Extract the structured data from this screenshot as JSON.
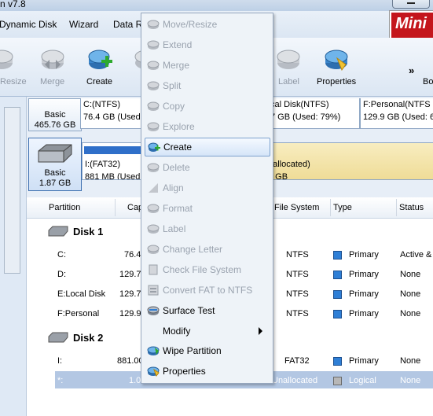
{
  "app": {
    "title": "n v7.8",
    "logo": "Mini"
  },
  "menubar": {
    "items": [
      "Dynamic Disk",
      "Wizard",
      "Data R"
    ]
  },
  "toolbar": {
    "items": [
      {
        "label": "Resize",
        "icon": "disk-resize-icon",
        "disabled": true
      },
      {
        "label": "Merge",
        "icon": "disk-merge-icon",
        "disabled": true
      },
      {
        "label": "Create",
        "icon": "disk-create-icon",
        "disabled": false
      },
      {
        "label": "Label",
        "icon": "disk-label-icon",
        "disabled": true
      },
      {
        "label": "Properties",
        "icon": "disk-properties-icon",
        "disabled": false
      }
    ],
    "more": "»",
    "cut_label": "Bo"
  },
  "diskmap": {
    "disk1": {
      "basic": "Basic",
      "size": "465.76 GB",
      "partitions": [
        {
          "line1": "C:(NTFS)",
          "line2": "76.4 GB (Used"
        },
        {
          "line1": "cal Disk(NTFS)",
          "line2": "7 GB (Used: 79%)"
        },
        {
          "line1": "F:Personal(NTFS",
          "line2": "129.9 GB (Used: 6"
        }
      ]
    },
    "disk2": {
      "basic": "Basic",
      "size": "1.87 GB",
      "partitions": [
        {
          "line1": "I:(FAT32)",
          "line2": "881 MB (Used:"
        },
        {
          "line1": "nallocated)",
          "line2": "0 GB"
        }
      ]
    }
  },
  "table": {
    "headers": [
      "Partition",
      "Cap",
      "File System",
      "Type",
      "Status"
    ],
    "disk1_title": "Disk 1",
    "disk2_title": "Disk 2",
    "rows": [
      {
        "partition": "C:",
        "cap": "76.4",
        "fs": "NTFS",
        "type": "Primary",
        "status": "Active &"
      },
      {
        "partition": "D:",
        "cap": "129.7",
        "fs": "NTFS",
        "type": "Primary",
        "status": "None"
      },
      {
        "partition": "E:Local Disk",
        "cap": "129.7",
        "fs": "NTFS",
        "type": "Primary",
        "status": "None"
      },
      {
        "partition": "F:Personal",
        "cap": "129.9",
        "fs": "NTFS",
        "type": "Primary",
        "status": "None"
      },
      {
        "partition": "I:",
        "cap": "881.00",
        "fs": "FAT32",
        "type": "Primary",
        "status": "None"
      },
      {
        "partition": "*:",
        "cap": "1.0",
        "fs": "Unallocated",
        "type": "Logical",
        "status": "None"
      }
    ]
  },
  "context_menu": {
    "items": [
      {
        "label": "Move/Resize",
        "icon": "move-resize-icon",
        "disabled": true
      },
      {
        "label": "Extend",
        "icon": "extend-icon",
        "disabled": true
      },
      {
        "label": "Merge",
        "icon": "merge-icon",
        "disabled": true
      },
      {
        "label": "Split",
        "icon": "split-icon",
        "disabled": true
      },
      {
        "label": "Copy",
        "icon": "copy-icon",
        "disabled": true
      },
      {
        "label": "Explore",
        "icon": "explore-icon",
        "disabled": true
      },
      {
        "label": "Create",
        "icon": "create-icon",
        "disabled": false,
        "highlighted": true
      },
      {
        "label": "Delete",
        "icon": "delete-icon",
        "disabled": true
      },
      {
        "label": "Align",
        "icon": "align-icon",
        "disabled": true
      },
      {
        "label": "Format",
        "icon": "format-icon",
        "disabled": true
      },
      {
        "label": "Label",
        "icon": "label-icon",
        "disabled": true
      },
      {
        "label": "Change Letter",
        "icon": "change-letter-icon",
        "disabled": true
      },
      {
        "label": "Check File System",
        "icon": "check-file-system-icon",
        "disabled": true
      },
      {
        "label": "Convert FAT to NTFS",
        "icon": "convert-fat-icon",
        "disabled": true
      },
      {
        "label": "Surface Test",
        "icon": "surface-test-icon",
        "disabled": false
      },
      {
        "label": "Modify",
        "icon": "",
        "disabled": false,
        "submenu": true
      },
      {
        "label": "Wipe Partition",
        "icon": "wipe-partition-icon",
        "disabled": false
      },
      {
        "label": "Properties",
        "icon": "properties-icon",
        "disabled": false
      }
    ]
  },
  "colors": {
    "accent": "#2f7fd6",
    "logo": "#c4161c",
    "highlight": "#d5e5f8",
    "disabled_text": "#9aa3af"
  }
}
